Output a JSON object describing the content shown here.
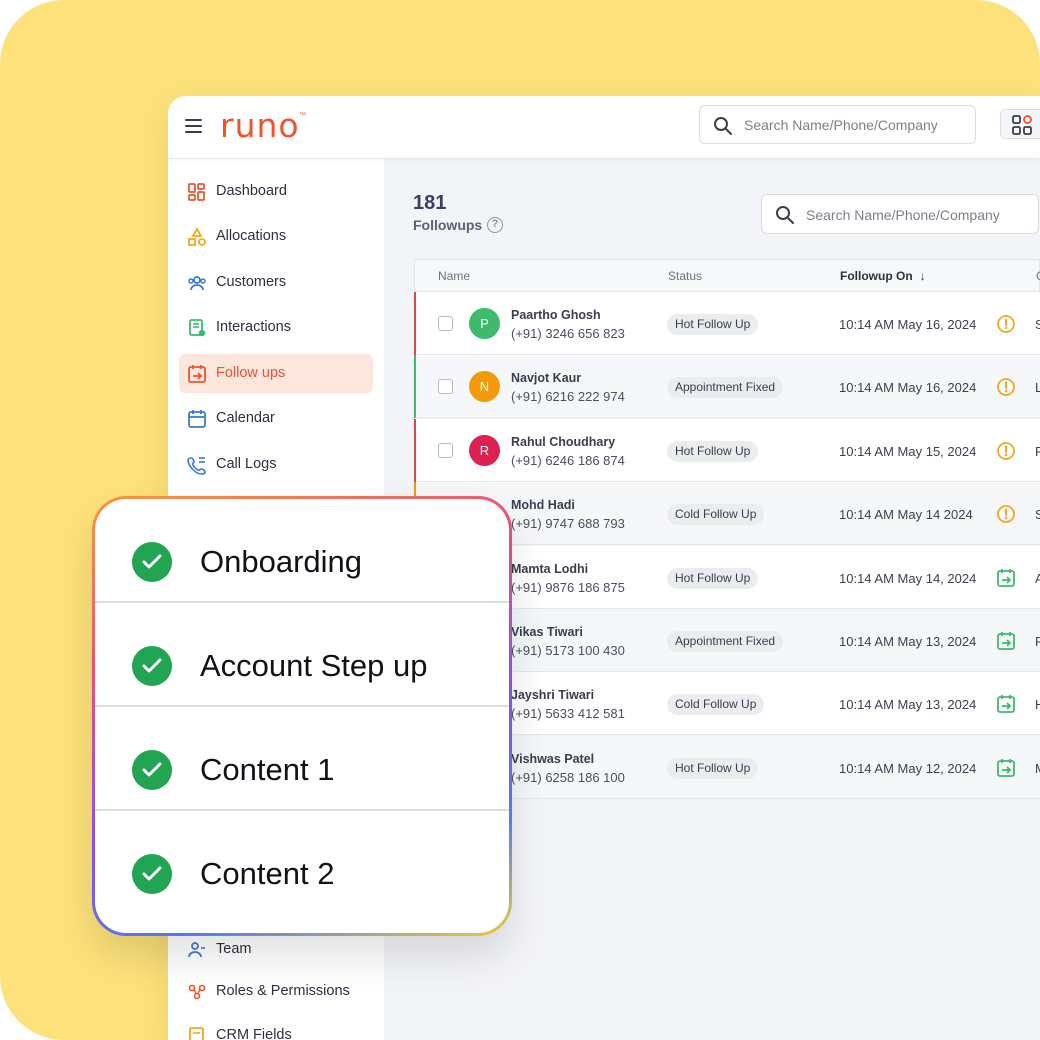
{
  "app": {
    "logo": "runo",
    "logo_tm": "™",
    "top_search_placeholder": "Search Name/Phone/Company"
  },
  "sidebar": {
    "items": [
      {
        "label": "Dashboard",
        "icon": "dashboard-icon",
        "active": false
      },
      {
        "label": "Allocations",
        "icon": "allocations-icon",
        "active": false
      },
      {
        "label": "Customers",
        "icon": "customers-icon",
        "active": false
      },
      {
        "label": "Interactions",
        "icon": "interactions-icon",
        "active": false
      },
      {
        "label": "Follow ups",
        "icon": "follow-ups-icon",
        "active": true
      },
      {
        "label": "Calendar",
        "icon": "calendar-icon",
        "active": false
      },
      {
        "label": "Call Logs",
        "icon": "call-logs-icon",
        "active": false
      },
      {
        "label": "Team",
        "icon": "team-icon",
        "active": false
      },
      {
        "label": "Roles & Permissions",
        "icon": "roles-icon",
        "active": false
      },
      {
        "label": "CRM Fields",
        "icon": "crm-fields-icon",
        "active": false
      }
    ]
  },
  "main": {
    "count": "181",
    "count_label": "Followups",
    "search_placeholder": "Search Name/Phone/Company",
    "columns": {
      "name": "Name",
      "status": "Status",
      "followup_on": "Followup On",
      "next": "C"
    }
  },
  "rows": [
    {
      "initial": "P",
      "avatar_color": "#3dba6c",
      "bar_color": "#e0454a",
      "name": "Paartho Ghosh",
      "phone": "(+91) 3246 656 823",
      "status": "Hot Follow Up",
      "date": "10:14 AM May 16, 2024",
      "icon": "alert-icon",
      "trail": "S"
    },
    {
      "initial": "N",
      "avatar_color": "#f29a0c",
      "bar_color": "#3dba6c",
      "name": "Navjot Kaur",
      "phone": "(+91) 6216 222 974",
      "status": "Appointment Fixed",
      "date": "10:14 AM May 16, 2024",
      "icon": "alert-icon",
      "trail": "L"
    },
    {
      "initial": "R",
      "avatar_color": "#dd2150",
      "bar_color": "#e0454a",
      "name": "Rahul Choudhary",
      "phone": "(+91) 6246 186 874",
      "status": "Hot Follow Up",
      "date": "10:14 AM May 15, 2024",
      "icon": "alert-icon",
      "trail": "P"
    },
    {
      "initial": "",
      "avatar_color": "",
      "bar_color": "#f29a0c",
      "name": "Mohd Hadi",
      "phone": "(+91) 9747 688 793",
      "status": "Cold Follow Up",
      "date": "10:14 AM May 14 2024",
      "icon": "alert-icon",
      "trail": "S"
    },
    {
      "initial": "",
      "avatar_color": "",
      "bar_color": "",
      "name": "Mamta Lodhi",
      "phone": "(+91) 9876 186 875",
      "status": "Hot Follow Up",
      "date": "10:14 AM May 14, 2024",
      "icon": "reschedule-icon",
      "trail": "A"
    },
    {
      "initial": "",
      "avatar_color": "",
      "bar_color": "",
      "name": "Vikas Tiwari",
      "phone": "(+91) 5173 100 430",
      "status": "Appointment Fixed",
      "date": "10:14 AM May 13, 2024",
      "icon": "reschedule-icon",
      "trail": "P"
    },
    {
      "initial": "",
      "avatar_color": "",
      "bar_color": "",
      "name": "Jayshri Tiwari",
      "phone": "(+91) 5633 412 581",
      "status": "Cold Follow Up",
      "date": "10:14 AM May 13, 2024",
      "icon": "reschedule-icon",
      "trail": "H"
    },
    {
      "initial": "",
      "avatar_color": "",
      "bar_color": "",
      "name": "Vishwas Patel",
      "phone": "(+91) 6258 186 100",
      "status": "Hot Follow Up",
      "date": "10:14 AM May 12, 2024",
      "icon": "reschedule-icon",
      "trail": "M"
    }
  ],
  "checklist": [
    {
      "label": "Onboarding",
      "done": true
    },
    {
      "label": "Account Step up",
      "done": true
    },
    {
      "label": "Content 1",
      "done": true
    },
    {
      "label": "Content 2",
      "done": true
    }
  ],
  "colors": {
    "background": "#fde27b",
    "brand": "#f0542e",
    "active_nav_bg": "#fde6de",
    "check_green": "#22a552",
    "alert_amber": "#f2a91c",
    "reschedule_green": "#3dba6c"
  }
}
